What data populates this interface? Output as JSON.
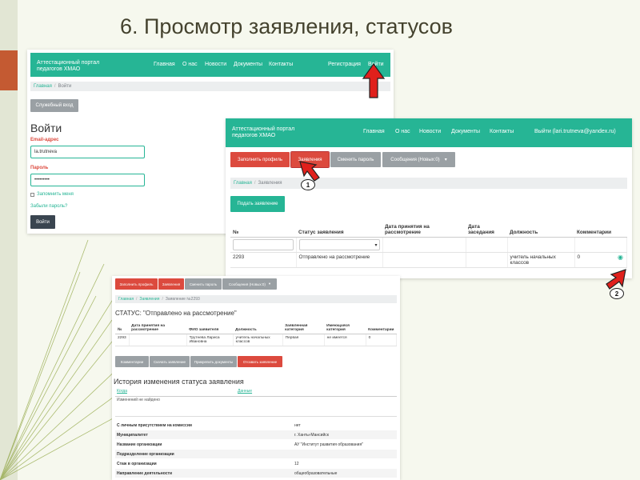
{
  "slide": {
    "title": "6. Просмотр заявления, статусов"
  },
  "colors": {
    "teal": "#26b595",
    "red": "#dc4a3e",
    "gray": "#9aa0a4",
    "accent": "#c45a32"
  },
  "login": {
    "brand_line1": "Аттестационный портал",
    "brand_line2": "педагогов ХМАО",
    "nav": [
      "Главная",
      "О нас",
      "Новости",
      "Документы",
      "Контакты"
    ],
    "register": "Регистрация",
    "login_link": "Войти",
    "crumb_home": "Главная",
    "crumb_current": "Войти",
    "service_button": "Служебный вход",
    "heading": "Войти",
    "email_label": "Email-адрес",
    "email_value": "la.trutneva",
    "password_label": "Пароль",
    "password_value": "•••••••••",
    "remember": "Запомнить меня",
    "forgot": "Забыли пароль?",
    "submit": "Войти"
  },
  "statements": {
    "brand_line1": "Аттестационный портал",
    "brand_line2": "педагогов ХМАО",
    "nav": [
      "Главная",
      "О нас",
      "Новости",
      "Документы",
      "Контакты"
    ],
    "user": "Выйти (lari.trutneva@yandex.ru)",
    "buttons": {
      "fill_profile": "Заполнить профиль",
      "statements": "Заявления",
      "change_password": "Сменить пароль",
      "messages": "Сообщения (Новых:0)"
    },
    "crumb_home": "Главная",
    "crumb_current": "Заявления",
    "submit_button": "Подать заявление",
    "columns": [
      "№",
      "Статус заявления",
      "Дата принятия на рассмотрение",
      "Дата заседания",
      "Должность",
      "Комментарии"
    ],
    "row": {
      "num": "2293",
      "status": "Отправлено на рассмотрение",
      "date_accept": "",
      "date_meeting": "",
      "position": "учитель начальных классов",
      "comments": "0"
    }
  },
  "detail": {
    "buttons": {
      "fill_profile": "Заполнить профиль",
      "statements": "Заявления",
      "change_password": "Сменить пароль",
      "messages": "Сообщения (Новых:0)"
    },
    "crumb_home": "Главная",
    "crumb_mid": "Заявления",
    "crumb_current": "Заявление №2293",
    "status_title": "СТАТУС: \"Отправлено на рассмотрение\"",
    "columns": [
      "№",
      "Дата принятия на рассмотрение",
      "ФИО заявителя",
      "Должность",
      "Заявленная категория",
      "Имеющаяся категория",
      "Комментарии"
    ],
    "row": {
      "num": "2293",
      "date": "",
      "fio": "Трутнева Лариса Ивановна",
      "position": "учитель начальных классов",
      "claimed": "Первая",
      "existing": "не имеется",
      "comments": "0"
    },
    "actions": {
      "comments": "Комментарии",
      "download": "Скачать заявление",
      "attach": "Прикрепить документы",
      "cancel": "Отозвать заявление"
    },
    "history_title": "История изменения статуса заявления",
    "history_cols": [
      "Когда",
      "Данные"
    ],
    "history_note": "Изменений не найдено",
    "fields": [
      {
        "k": "С личным присутствием на комиссии",
        "v": "нет"
      },
      {
        "k": "Муниципалитет",
        "v": "г. Ханты-Мансийск"
      },
      {
        "k": "Название организации",
        "v": "АУ \"Институт развития образования\""
      },
      {
        "k": "Подразделение организации",
        "v": ""
      },
      {
        "k": "Стаж в организации",
        "v": "12"
      },
      {
        "k": "Направление деятельности",
        "v": "общеобразовательные"
      }
    ]
  },
  "markers": {
    "one": "1",
    "two": "2"
  }
}
